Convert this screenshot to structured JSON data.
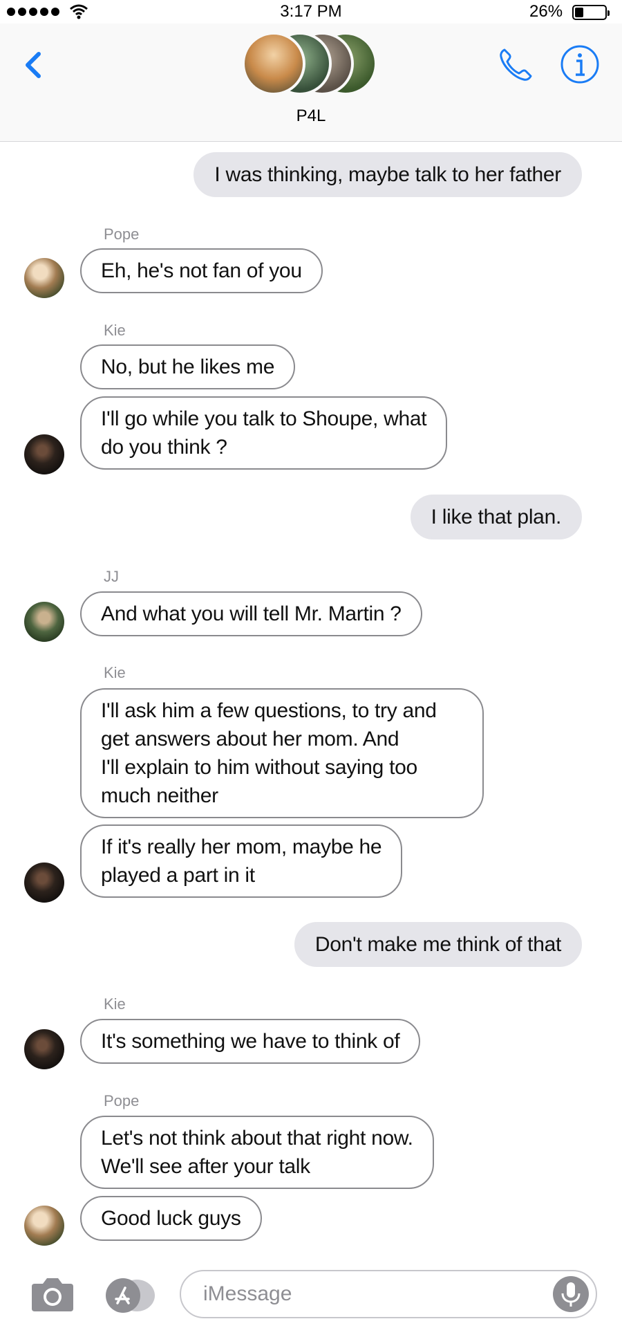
{
  "status_bar": {
    "time": "3:17 PM",
    "battery_text": "26%"
  },
  "header": {
    "group_name": "P4L"
  },
  "messages": [
    {
      "id": "m1",
      "text": "I was thinking, maybe talk to her father"
    },
    {
      "id": "m2",
      "sender": "Pope",
      "text": "Eh, he's not fan of you"
    },
    {
      "id": "m3",
      "sender": "Kie",
      "text": "No, but he likes me"
    },
    {
      "id": "m4",
      "text": "I'll go while you talk to Shoupe, what\ndo you think ?"
    },
    {
      "id": "m5",
      "text": "I like that plan."
    },
    {
      "id": "m6",
      "sender": "JJ",
      "text": "And what you will tell Mr. Martin ?"
    },
    {
      "id": "m7",
      "sender": "Kie",
      "text": "I'll ask him a few questions, to try and\nget answers about her mom. And\nI'll explain to him without saying too\nmuch neither"
    },
    {
      "id": "m8",
      "text": "If it's really her mom, maybe he\nplayed a part in it"
    },
    {
      "id": "m9",
      "text": "Don't make me think of that"
    },
    {
      "id": "m10",
      "sender": "Kie",
      "text": "It's something we have to think of"
    },
    {
      "id": "m11",
      "sender": "Pope",
      "text": "Let's not think about that right now.\nWe'll see after your talk"
    },
    {
      "id": "m12",
      "text": "Good luck guys"
    }
  ],
  "composer": {
    "placeholder": "iMessage"
  },
  "colors": {
    "accent": "#1a7cf5",
    "incoming_border": "#8a8a8e",
    "outgoing_bg": "#e5e5ea"
  },
  "icons": [
    "back-chevron-icon",
    "phone-icon",
    "info-icon",
    "camera-icon",
    "app-store-icon",
    "microphone-icon"
  ]
}
